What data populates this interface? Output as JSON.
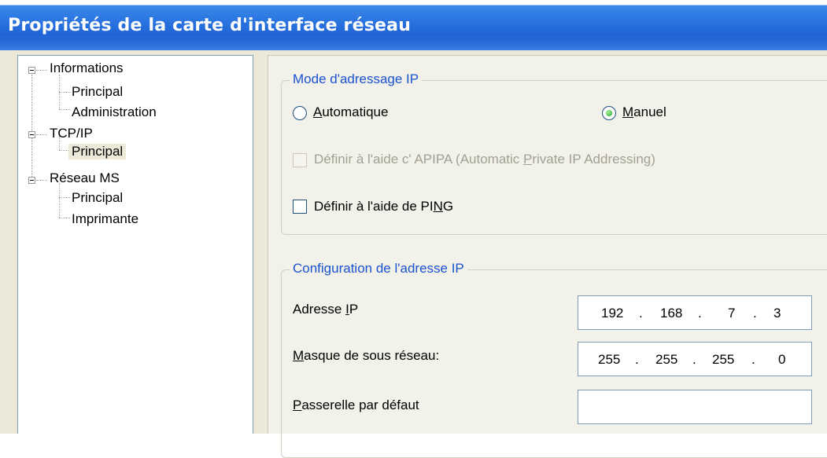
{
  "window": {
    "title": "Propriétés de la carte d'interface réseau"
  },
  "tree": {
    "informations": {
      "label": "Informations",
      "children": [
        "Principal",
        "Administration"
      ]
    },
    "tcpip": {
      "label": "TCP/IP",
      "children": [
        "Principal"
      ]
    },
    "reseau_ms": {
      "label": "Réseau MS",
      "children": [
        "Principal",
        "Imprimante"
      ]
    }
  },
  "mode_group": {
    "legend": "Mode d'adressage IP",
    "auto": {
      "pre": "",
      "u": "A",
      "post": "utomatique"
    },
    "manual": {
      "pre": "",
      "u": "M",
      "post": "anuel"
    },
    "apipa": {
      "pre": "Définir à l'aide c' APIPA (Automatic ",
      "u": "P",
      "post": "rivate IP Addressing)"
    },
    "ping": {
      "pre": "Définir à l'aide de PI",
      "u": "N",
      "post": "G"
    }
  },
  "ip_group": {
    "legend": "Configuration de l'adresse IP",
    "ip_label": {
      "pre": "Adresse ",
      "u": "I",
      "post": "P"
    },
    "mask_label": {
      "pre": "",
      "u": "M",
      "post": "asque de sous réseau:"
    },
    "gateway_label": {
      "pre": "",
      "u": "P",
      "post": "asserelle par défaut"
    },
    "ip": [
      "192",
      "168",
      "7",
      "3"
    ],
    "mask": [
      "255",
      "255",
      "255",
      "0"
    ],
    "separator": "."
  },
  "colors": {
    "title_bar": "#2a6fdb",
    "legend": "#1a52d0",
    "radio_on": "#21a121"
  }
}
